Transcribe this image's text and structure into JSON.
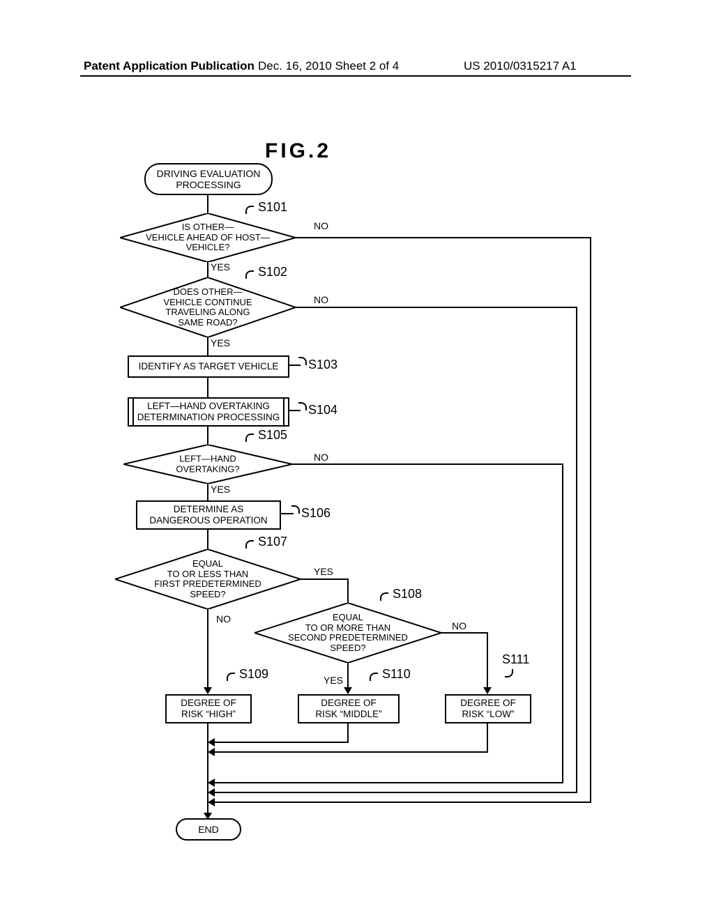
{
  "header": {
    "left": "Patent Application Publication",
    "center": "Dec. 16, 2010  Sheet 2 of 4",
    "right": "US 2010/0315217 A1"
  },
  "figure_title": "FIG.2",
  "nodes": {
    "start": "DRIVING EVALUATION\nPROCESSING",
    "s101": "IS OTHER—\nVEHICLE AHEAD OF HOST—\nVEHICLE?",
    "s102": "DOES OTHER—\nVEHICLE CONTINUE\nTRAVELING ALONG\nSAME ROAD?",
    "s103": "IDENTIFY AS TARGET VEHICLE",
    "s104": "LEFT—HAND OVERTAKING\nDETERMINATION PROCESSING",
    "s105": "LEFT—HAND\nOVERTAKING?",
    "s106": "DETERMINE AS\nDANGEROUS OPERATION",
    "s107": "EQUAL\nTO OR LESS THAN\nFIRST PREDETERMINED\nSPEED?",
    "s108": "EQUAL\nTO OR MORE THAN\nSECOND PREDETERMINED\nSPEED?",
    "s109": "DEGREE OF\nRISK “HIGH”",
    "s110": "DEGREE OF\nRISK “MIDDLE”",
    "s111": "DEGREE OF\nRISK “LOW”",
    "end": "END"
  },
  "step_labels": {
    "s101": "S101",
    "s102": "S102",
    "s103": "S103",
    "s104": "S104",
    "s105": "S105",
    "s106": "S106",
    "s107": "S107",
    "s108": "S108",
    "s109": "S109",
    "s110": "S110",
    "s111": "S111"
  },
  "branch_labels": {
    "yes": "YES",
    "no": "NO"
  },
  "chart_data": {
    "type": "flowchart",
    "title": "FIG.2 Driving Evaluation Processing",
    "start": "start",
    "end": "end",
    "nodes": [
      {
        "id": "start",
        "type": "terminal",
        "text": "DRIVING EVALUATION PROCESSING"
      },
      {
        "id": "s101",
        "type": "decision",
        "label": "S101",
        "text": "IS OTHER-VEHICLE AHEAD OF HOST-VEHICLE?"
      },
      {
        "id": "s102",
        "type": "decision",
        "label": "S102",
        "text": "DOES OTHER-VEHICLE CONTINUE TRAVELING ALONG SAME ROAD?"
      },
      {
        "id": "s103",
        "type": "process",
        "label": "S103",
        "text": "IDENTIFY AS TARGET VEHICLE"
      },
      {
        "id": "s104",
        "type": "subprocess",
        "label": "S104",
        "text": "LEFT-HAND OVERTAKING DETERMINATION PROCESSING"
      },
      {
        "id": "s105",
        "type": "decision",
        "label": "S105",
        "text": "LEFT-HAND OVERTAKING?"
      },
      {
        "id": "s106",
        "type": "process",
        "label": "S106",
        "text": "DETERMINE AS DANGEROUS OPERATION"
      },
      {
        "id": "s107",
        "type": "decision",
        "label": "S107",
        "text": "EQUAL TO OR LESS THAN FIRST PREDETERMINED SPEED?"
      },
      {
        "id": "s108",
        "type": "decision",
        "label": "S108",
        "text": "EQUAL TO OR MORE THAN SECOND PREDETERMINED SPEED?"
      },
      {
        "id": "s109",
        "type": "process",
        "label": "S109",
        "text": "DEGREE OF RISK \"HIGH\""
      },
      {
        "id": "s110",
        "type": "process",
        "label": "S110",
        "text": "DEGREE OF RISK \"MIDDLE\""
      },
      {
        "id": "s111",
        "type": "process",
        "label": "S111",
        "text": "DEGREE OF RISK \"LOW\""
      },
      {
        "id": "end",
        "type": "terminal",
        "text": "END"
      }
    ],
    "edges": [
      {
        "from": "start",
        "to": "s101"
      },
      {
        "from": "s101",
        "to": "s102",
        "label": "YES"
      },
      {
        "from": "s101",
        "to": "end",
        "label": "NO"
      },
      {
        "from": "s102",
        "to": "s103",
        "label": "YES"
      },
      {
        "from": "s102",
        "to": "end",
        "label": "NO"
      },
      {
        "from": "s103",
        "to": "s104"
      },
      {
        "from": "s104",
        "to": "s105"
      },
      {
        "from": "s105",
        "to": "s106",
        "label": "YES"
      },
      {
        "from": "s105",
        "to": "end",
        "label": "NO"
      },
      {
        "from": "s106",
        "to": "s107"
      },
      {
        "from": "s107",
        "to": "s108",
        "label": "YES"
      },
      {
        "from": "s107",
        "to": "s109",
        "label": "NO"
      },
      {
        "from": "s108",
        "to": "s110",
        "label": "YES"
      },
      {
        "from": "s108",
        "to": "s111",
        "label": "NO"
      },
      {
        "from": "s109",
        "to": "end"
      },
      {
        "from": "s110",
        "to": "end"
      },
      {
        "from": "s111",
        "to": "end"
      }
    ]
  }
}
